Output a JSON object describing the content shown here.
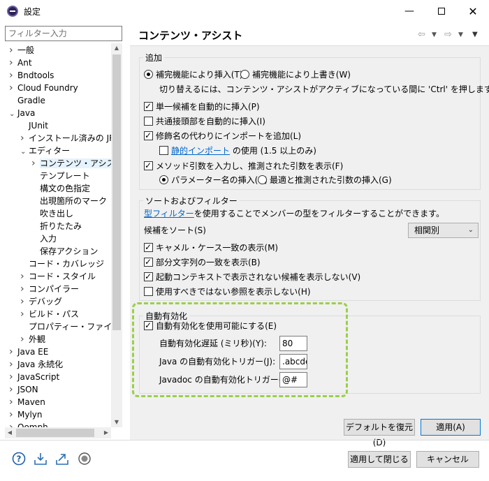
{
  "window": {
    "title": "設定"
  },
  "filter": {
    "placeholder": "フィルター入力"
  },
  "tree": [
    {
      "label": "一般",
      "level": 0,
      "twisty": ">"
    },
    {
      "label": "Ant",
      "level": 0,
      "twisty": ">"
    },
    {
      "label": "Bndtools",
      "level": 0,
      "twisty": ">"
    },
    {
      "label": "Cloud Foundry",
      "level": 0,
      "twisty": ">"
    },
    {
      "label": "Gradle",
      "level": 0,
      "twisty": ""
    },
    {
      "label": "Java",
      "level": 0,
      "twisty": "v"
    },
    {
      "label": "JUnit",
      "level": 1,
      "twisty": ""
    },
    {
      "label": "インストール済みの JRE",
      "level": 1,
      "twisty": ">"
    },
    {
      "label": "エディター",
      "level": 1,
      "twisty": "v"
    },
    {
      "label": "コンテンツ・アシスト",
      "level": 2,
      "twisty": ">",
      "selected": true
    },
    {
      "label": "テンプレート",
      "level": 2,
      "twisty": ""
    },
    {
      "label": "構文の色指定",
      "level": 2,
      "twisty": ""
    },
    {
      "label": "出現箇所のマーク",
      "level": 2,
      "twisty": ""
    },
    {
      "label": "吹き出し",
      "level": 2,
      "twisty": ""
    },
    {
      "label": "折りたたみ",
      "level": 2,
      "twisty": ""
    },
    {
      "label": "入力",
      "level": 2,
      "twisty": ""
    },
    {
      "label": "保存アクション",
      "level": 2,
      "twisty": ""
    },
    {
      "label": "コード・カバレッジ",
      "level": 1,
      "twisty": ""
    },
    {
      "label": "コード・スタイル",
      "level": 1,
      "twisty": ">"
    },
    {
      "label": "コンパイラー",
      "level": 1,
      "twisty": ">"
    },
    {
      "label": "デバッグ",
      "level": 1,
      "twisty": ">"
    },
    {
      "label": "ビルド・パス",
      "level": 1,
      "twisty": ">"
    },
    {
      "label": "プロパティー・ファイル・エデ",
      "level": 1,
      "twisty": ""
    },
    {
      "label": "外観",
      "level": 1,
      "twisty": ">"
    },
    {
      "label": "Java EE",
      "level": 0,
      "twisty": ">"
    },
    {
      "label": "Java 永続化",
      "level": 0,
      "twisty": ">"
    },
    {
      "label": "JavaScript",
      "level": 0,
      "twisty": ">"
    },
    {
      "label": "JSON",
      "level": 0,
      "twisty": ">"
    },
    {
      "label": "Maven",
      "level": 0,
      "twisty": ">"
    },
    {
      "label": "Mylyn",
      "level": 0,
      "twisty": ">"
    },
    {
      "label": "Oomph",
      "level": 0,
      "twisty": ">"
    }
  ],
  "page": {
    "title": "コンテンツ・アシスト",
    "insertion": {
      "label": "追加",
      "radio_insert": "補完機能により挿入(T)",
      "radio_overwrite": "補完機能により上書き(W)",
      "hint": "切り替えるには、コンテンツ・アシストがアクティブになっている間に 'Ctrl' を押します",
      "cb_single": "単一候補を自動的に挿入(P)",
      "cb_common": "共通接頭部を自動的に挿入(I)",
      "cb_import": "修飾名の代わりにインポートを追加(L)",
      "static_link": "静的インポート",
      "static_rest": "の使用 (1.5 以上のみ)",
      "cb_params": "メソッド引数を入力し、推測された引数を表示(F)",
      "radio_param_names": "パラメーター名の挿入(N)",
      "radio_best_guess": "最適と推測された引数の挿入(G)"
    },
    "sorting": {
      "label": "ソートおよびフィルター",
      "type_link": "型フィルター",
      "type_rest": "を使用することでメンバーの型をフィルターすることができます。",
      "sort_label": "候補をソート(S)",
      "sort_value": "相関別",
      "cb_camel": "キャメル・ケース一致の表示(M)",
      "cb_substring": "部分文字列の一致を表示(B)",
      "cb_hide_context": "起動コンテキストで表示されない候補を表示しない(V)",
      "cb_hide_deprecated": "使用すべきではない参照を表示しない(H)"
    },
    "auto": {
      "label": "自動有効化",
      "cb_enable": "自動有効化を使用可能にする(E)",
      "delay_label": "自動有効化遅延 (ミリ秒)(Y):",
      "delay_value": "80",
      "java_label": "Java の自動有効化トリガー(J):",
      "java_value": ".abcdefghijklmnopqrstuvwxyz",
      "javadoc_label": "Javadoc の自動有効化トリガー(O):",
      "javadoc_value": "@#"
    },
    "restore_defaults": "デフォルトを復元(D)",
    "apply": "適用(A)"
  },
  "footer": {
    "apply_close": "適用して閉じる",
    "cancel": "キャンセル"
  }
}
